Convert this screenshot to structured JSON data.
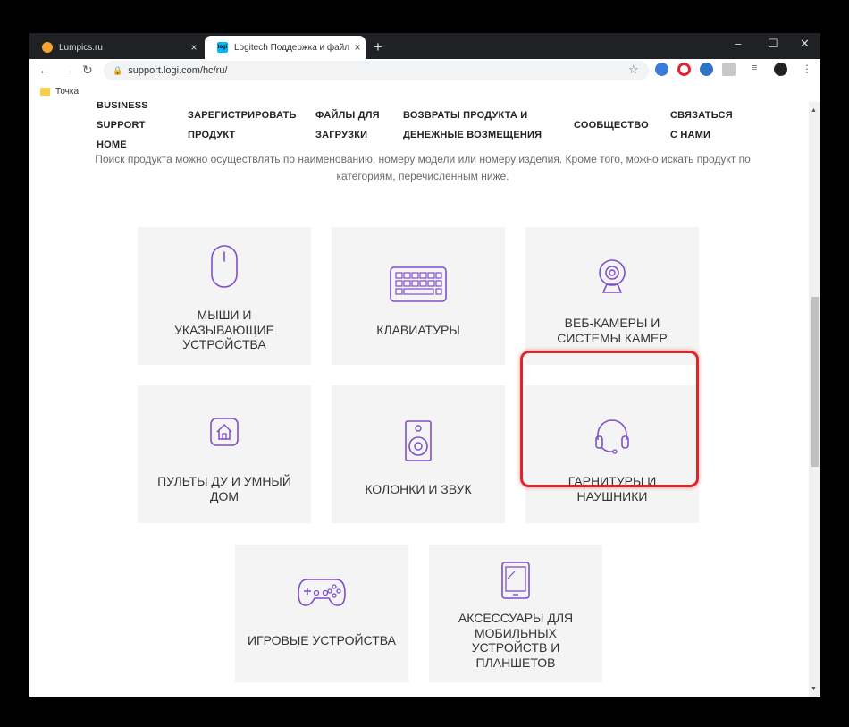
{
  "browser": {
    "tabs": [
      {
        "title": "Lumpics.ru",
        "close": "×"
      },
      {
        "title": "Logitech Поддержка и файлы для загрузки",
        "favicon_text": "logi",
        "close": "×"
      }
    ],
    "new_tab": "+",
    "controls": {
      "minimize": "–",
      "maximize": "☐",
      "close": "✕"
    },
    "url": "support.logi.com/hc/ru/",
    "bookmark": "Точка"
  },
  "nav": {
    "business": "BUSINESS",
    "support": "SUPPORT",
    "home": "HOME",
    "register_1": "ЗАРЕГИСТРИРОВАТЬ",
    "register_2": "ПРОДУКТ",
    "downloads_1": "ФАЙЛЫ ДЛЯ",
    "downloads_2": "ЗАГРУЗКИ",
    "returns_1": "ВОЗВРАТЫ ПРОДУКТА И",
    "returns_2": "ДЕНЕЖНЫЕ ВОЗМЕЩЕНИЯ",
    "community": "СООБЩЕСТВО",
    "contact_1": "СВЯЗАТЬСЯ",
    "contact_2": "С НАМИ"
  },
  "description": "Поиск продукта можно осуществлять по наименованию, номеру модели или номеру изделия. Кроме того, можно искать продукт по категориям, перечисленным ниже.",
  "categories": [
    {
      "label": "МЫШИ И УКАЗЫВАЮЩИЕ УСТРОЙСТВА",
      "icon": "mouse-icon"
    },
    {
      "label": "КЛАВИАТУРЫ",
      "icon": "keyboard-icon"
    },
    {
      "label": "ВЕБ-КАМЕРЫ И СИСТЕМЫ КАМЕР",
      "icon": "webcam-icon"
    },
    {
      "label": "ПУЛЬТЫ ДУ И УМНЫЙ ДОМ",
      "icon": "smart-home-icon"
    },
    {
      "label": "КОЛОНКИ И ЗВУК",
      "icon": "speaker-icon"
    },
    {
      "label": "ГАРНИТУРЫ И НАУШНИКИ",
      "icon": "headset-icon"
    },
    {
      "label": "ИГРОВЫЕ УСТРОЙСТВА",
      "icon": "gamepad-icon"
    },
    {
      "label": "АКСЕССУАРЫ ДЛЯ МОБИЛЬНЫХ УСТРОЙСТВ И ПЛАНШЕТОВ",
      "icon": "tablet-icon"
    }
  ],
  "colors": {
    "icon": "#7f4fc9",
    "highlight": "#e0242c",
    "card_bg": "#f4f4f4"
  }
}
